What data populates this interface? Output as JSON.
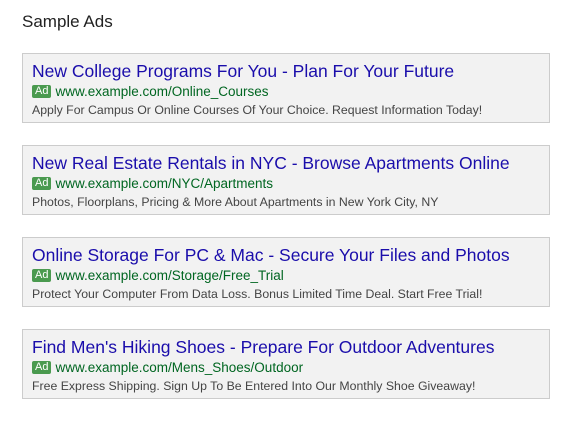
{
  "page": {
    "title": "Sample Ads"
  },
  "ads": [
    {
      "badge": "Ad",
      "headline": "New College Programs For You - Plan For Your Future",
      "display_url": "www.example.com/Online_Courses",
      "description": "Apply For Campus Or Online Courses Of Your Choice. Request Information Today!"
    },
    {
      "badge": "Ad",
      "headline": "New Real Estate Rentals in NYC - Browse Apartments Online",
      "display_url": "www.example.com/NYC/Apartments",
      "description": "Photos, Floorplans, Pricing & More About Apartments in New York City, NY"
    },
    {
      "badge": "Ad",
      "headline": "Online Storage For PC & Mac - Secure Your Files and Photos",
      "display_url": "www.example.com/Storage/Free_Trial",
      "description": "Protect Your Computer From Data Loss. Bonus Limited Time Deal. Start Free Trial!"
    },
    {
      "badge": "Ad",
      "headline": "Find Men's Hiking Shoes - Prepare For Outdoor Adventures",
      "display_url": "www.example.com/Mens_Shoes/Outdoor",
      "description": "Free Express Shipping. Sign Up To Be Entered Into Our Monthly Shoe Giveaway!"
    }
  ],
  "colors": {
    "headline": "#1a0dab",
    "url": "#006621",
    "badge": "#4a9a4f",
    "card_background": "#f2f2f2",
    "card_border": "#cccccc"
  }
}
